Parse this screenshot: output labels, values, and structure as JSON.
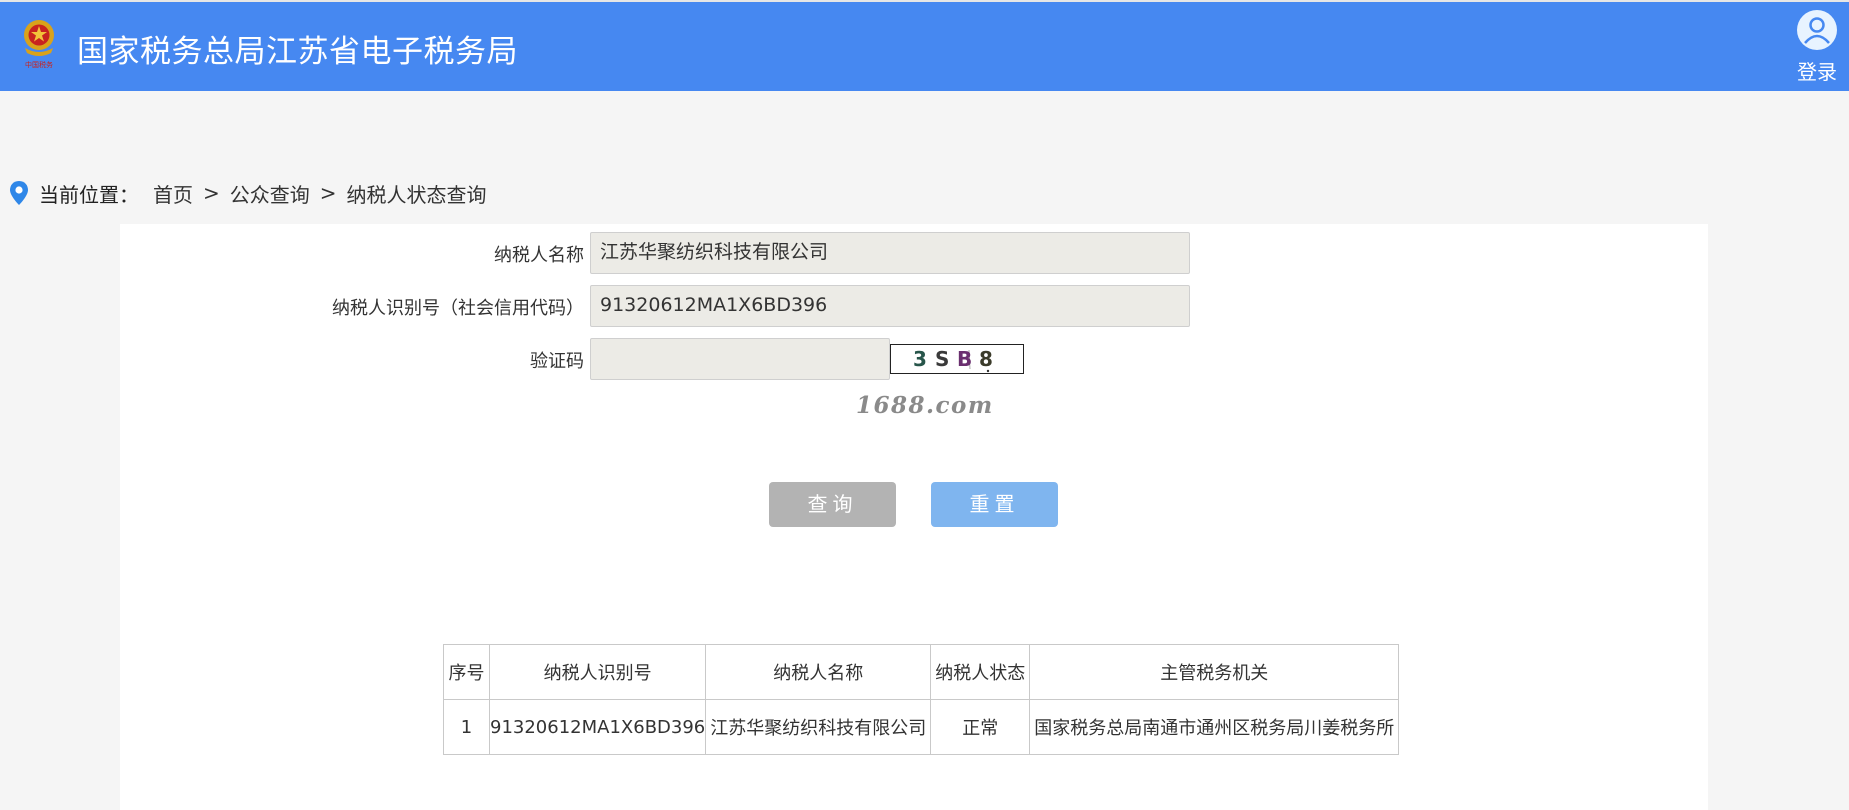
{
  "header": {
    "title": "国家税务总局江苏省电子税务局",
    "login_label": "登录"
  },
  "breadcrumb": {
    "label": "当前位置：",
    "items": [
      "首页",
      "公众查询",
      "纳税人状态查询"
    ],
    "separator": ">"
  },
  "form": {
    "name_label": "纳税人名称",
    "name_value": "江苏华聚纺织科技有限公司",
    "id_label": "纳税人识别号（社会信用代码）",
    "id_value": "91320612MA1X6BD396",
    "captcha_label": "验证码",
    "captcha_value": "",
    "captcha_text": "3SB8"
  },
  "watermark": "1688.com",
  "buttons": {
    "query": "查询",
    "reset": "重置"
  },
  "table": {
    "headers": [
      "序号",
      "纳税人识别号",
      "纳税人名称",
      "纳税人状态",
      "主管税务机关"
    ],
    "rows": [
      [
        "1",
        "91320612MA1X6BD396",
        "江苏华聚纺织科技有限公司",
        "正常",
        "国家税务总局南通市通州区税务局川姜税务所"
      ]
    ]
  },
  "colors": {
    "header_bg": "#4688f1",
    "query_button": "#b3b3b3",
    "reset_button": "#7fb5ef",
    "page_bg": "#f5f5f5",
    "input_bg": "#ecebe6"
  }
}
